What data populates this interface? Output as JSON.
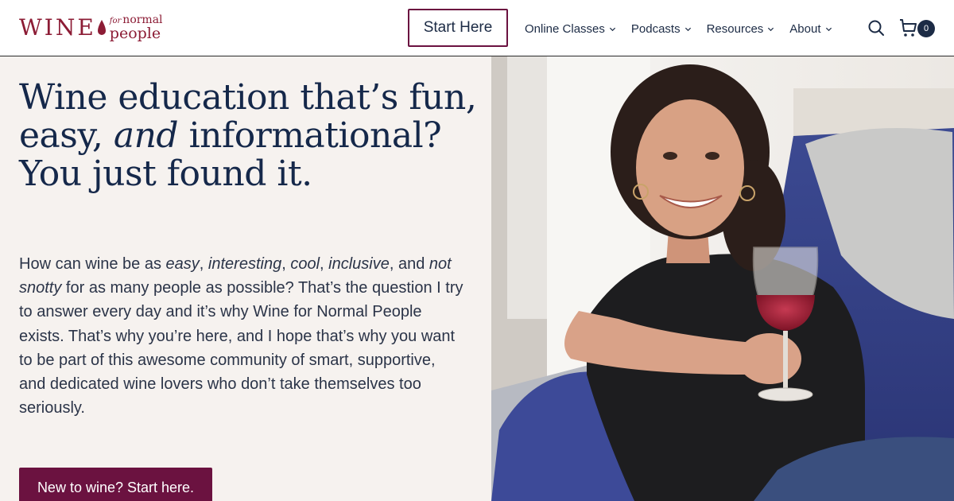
{
  "brand": {
    "logo_main": "WINE",
    "logo_for": "for",
    "logo_normal": "normal",
    "logo_people": "people",
    "color_primary": "#6b1240",
    "color_logo": "#8c1c35",
    "color_text": "#15284a"
  },
  "header": {
    "start_button": "Start Here",
    "nav": [
      {
        "label": "Online Classes",
        "icon": "chevron-down-icon"
      },
      {
        "label": "Podcasts",
        "icon": "chevron-down-icon"
      },
      {
        "label": "Resources",
        "icon": "chevron-down-icon"
      },
      {
        "label": "About",
        "icon": "chevron-down-icon"
      }
    ],
    "search_icon": "search-icon",
    "cart_icon": "cart-icon",
    "cart_count": "0"
  },
  "hero": {
    "title_part1": "Wine education that’s fun, easy,",
    "title_em": "and",
    "title_part2": "informational? You just found it.",
    "body": {
      "p1": "How can wine be as",
      "em1": "easy",
      "s1": ",",
      "em2": "interesting",
      "s2": ",",
      "em3": "cool",
      "s3": ",",
      "em4": "inclusive",
      "s4": ", and",
      "em5": "not snotty",
      "p2": "for as many people as possible? That’s the question I try to answer every day and it’s why Wine for Normal People exists. That’s why you’re here, and I hope that’s why you want to be part of this awesome community of smart, supportive, and dedicated wine lovers who don’t take themselves too seriously."
    },
    "cta": "New to wine? Start here."
  }
}
